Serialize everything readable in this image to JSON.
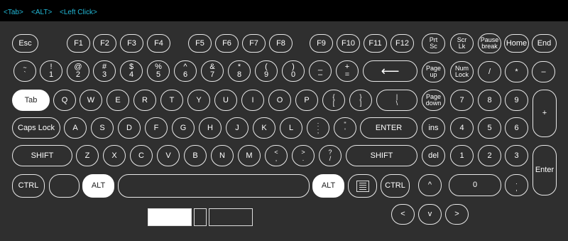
{
  "topbar": {
    "items": [
      "<Tab>",
      "<ALT>",
      "<Left Click>"
    ]
  },
  "keys": {
    "r1": [
      "Esc",
      "F1",
      "F2",
      "F3",
      "F4",
      "F5",
      "F6",
      "F7",
      "F8",
      "F9",
      "F10",
      "F11",
      "F12",
      "Prt\nSc",
      "Scr\nLk",
      "Pause\nbreak",
      "Home",
      "End"
    ],
    "r2": [
      "~\n`",
      "!\n1",
      "@\n2",
      "#\n3",
      "$\n4",
      "%\n5",
      "^\n6",
      "&\n7",
      "*\n8",
      "(\n9",
      ")\n0",
      "_\n–",
      "+\n=",
      "⟵",
      "Page\nup",
      "Num\nLock",
      "/",
      "*",
      "–"
    ],
    "r3": [
      "Tab",
      "Q",
      "W",
      "E",
      "R",
      "T",
      "Y",
      "U",
      "I",
      "O",
      "P",
      "{\n[",
      "}\n]",
      "|\n\\",
      "Page\ndown",
      "7",
      "8",
      "9",
      "+"
    ],
    "r4": [
      "Caps Lock",
      "A",
      "S",
      "D",
      "F",
      "G",
      "H",
      "J",
      "K",
      "L",
      ":\n;",
      "\"\n'",
      "ENTER",
      "ins",
      "4",
      "5",
      "6"
    ],
    "r5": [
      "SHIFT",
      "Z",
      "X",
      "C",
      "V",
      "B",
      "N",
      "M",
      "<\n,",
      ">\n.",
      "?\n/",
      "SHIFT",
      "del",
      "1",
      "2",
      "3",
      "Enter"
    ],
    "r6": [
      "CTRL",
      "",
      "ALT",
      "",
      "ALT",
      "",
      "CTRL",
      "^",
      "0",
      ".\n,"
    ],
    "r7": [
      "<",
      "v",
      ">"
    ]
  }
}
